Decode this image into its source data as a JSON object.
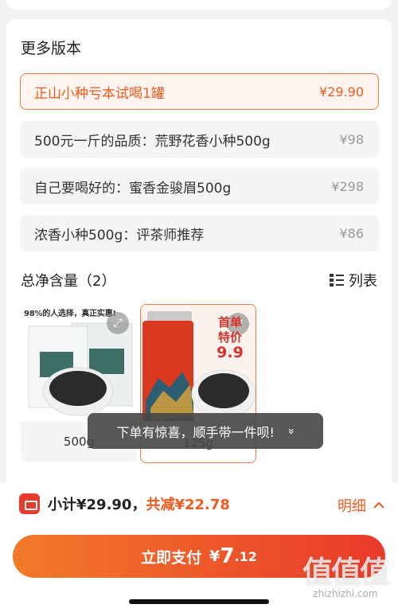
{
  "more_versions": {
    "title": "更多版本",
    "items": [
      {
        "label": "正山小种亏本试喝1罐",
        "price": "¥29.90",
        "selected": true
      },
      {
        "label": "500元一斤的品质：荒野花香小种500g",
        "price": "¥98",
        "selected": false
      },
      {
        "label": "自己要喝好的：蜜香金骏眉500g",
        "price": "¥298",
        "selected": false
      },
      {
        "label": "浓香小种500g：评茶师推荐",
        "price": "¥86",
        "selected": false
      }
    ]
  },
  "net_content": {
    "title": "总净含量（2）",
    "list_label": "列表",
    "options": [
      {
        "label": "500g",
        "promo_text": "98%的人选择，真正实惠!"
      },
      {
        "label": "125g",
        "badge_line1": "首单",
        "badge_line2": "特价",
        "badge_price": "9.9",
        "selected": true
      }
    ]
  },
  "toast": {
    "text": "下单有惊喜，顺手带一件呗!",
    "chevron": "»"
  },
  "footer": {
    "subtotal_label": "小计¥29.90，",
    "discount_label": "共减¥22.78",
    "details_label": "明细",
    "pay_label": "立即支付",
    "pay_currency": "¥",
    "pay_amount_int": "7",
    "pay_amount_dec": ".12"
  },
  "watermark": {
    "big": "值值值",
    "small": "zhizhizhi.com"
  },
  "colors": {
    "accent": "#ef5a1e",
    "button_gradient_start": "#f27a2a",
    "button_gradient_end": "#ea3a2a"
  }
}
